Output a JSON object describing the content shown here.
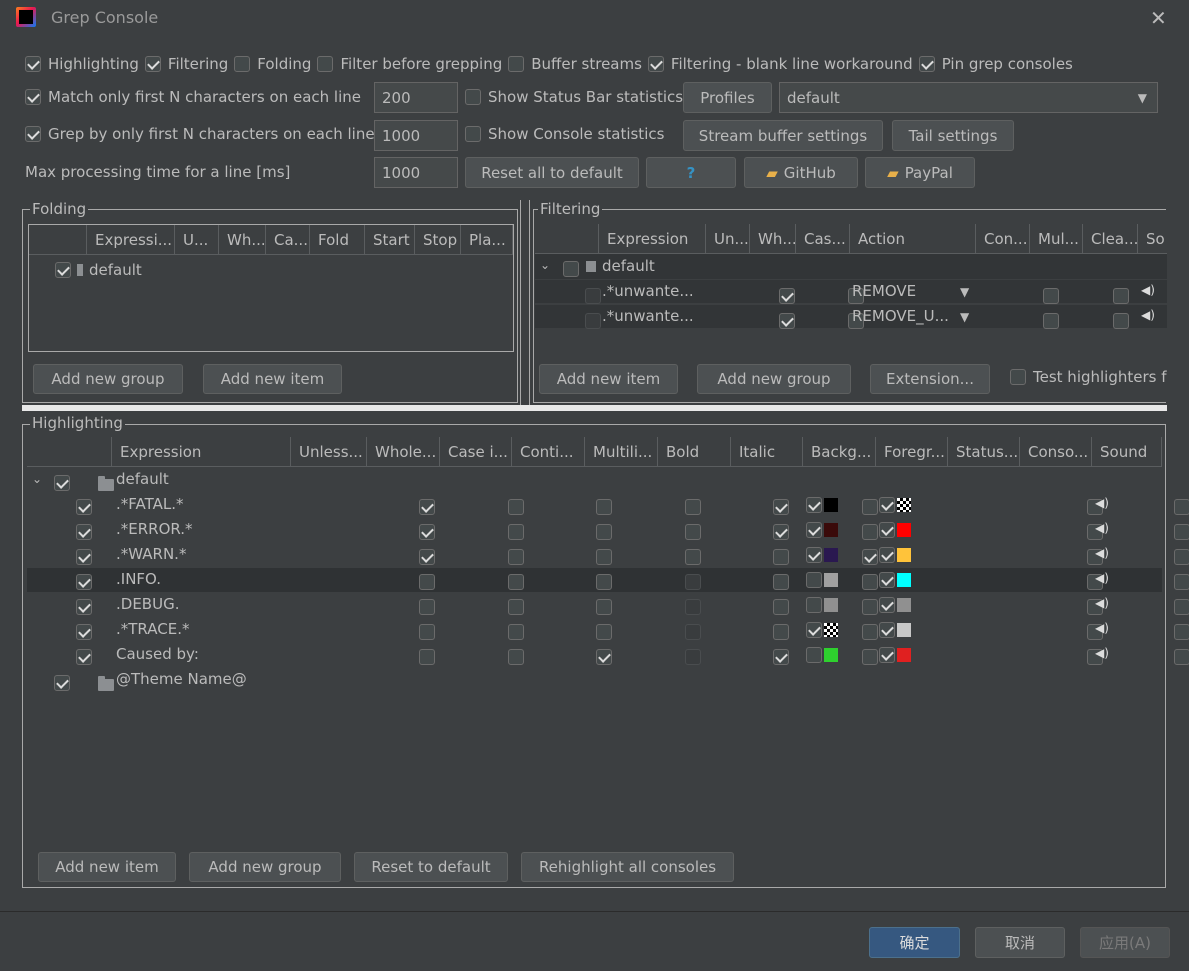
{
  "window": {
    "title": "Grep Console"
  },
  "options": {
    "row1": [
      {
        "label": "Highlighting",
        "checked": true
      },
      {
        "label": "Filtering",
        "checked": true
      },
      {
        "label": "Folding",
        "checked": false
      },
      {
        "label": "Filter before grepping",
        "checked": false
      },
      {
        "label": "Buffer streams",
        "checked": false
      },
      {
        "label": "Filtering - blank line workaround",
        "checked": true
      },
      {
        "label": "Pin grep consoles",
        "checked": true
      }
    ],
    "match_first_n": {
      "label": "Match only first N characters on each line",
      "checked": true,
      "value": "200"
    },
    "grep_first_n": {
      "label": "Grep by only first N characters on each line",
      "checked": true,
      "value": "1000"
    },
    "max_time": {
      "label": "Max processing time for a line [ms]",
      "value": "1000"
    },
    "status_bar_stats": {
      "label": "Show Status Bar statistics",
      "checked": false
    },
    "console_stats": {
      "label": "Show Console statistics",
      "checked": false
    },
    "profiles_label": "Profiles",
    "profile_selected": "default",
    "stream_buffer_label": "Stream buffer settings",
    "tail_settings_label": "Tail settings",
    "reset_all_label": "Reset all to default",
    "help_label": "?",
    "github_label": "GitHub",
    "paypal_label": "PayPal"
  },
  "folding": {
    "title": "Folding",
    "columns": [
      "Expressi...",
      "U...",
      "Wh...",
      "Ca...",
      "Fold",
      "Start",
      "Stop",
      "Pla..."
    ],
    "rows": [
      {
        "label": "default",
        "checked": true
      }
    ],
    "add_group": "Add new group",
    "add_item": "Add new item"
  },
  "filtering": {
    "title": "Filtering",
    "columns": [
      "Expression",
      "Un...",
      "Wh...",
      "Cas...",
      "Action",
      "Con...",
      "Mul...",
      "Clea...",
      "So"
    ],
    "group": "default",
    "rows": [
      {
        "expr": ".*unwante...",
        "action": "REMOVE"
      },
      {
        "expr": ".*unwante...",
        "action": "REMOVE_U..."
      }
    ],
    "add_item": "Add new item",
    "add_group": "Add new group",
    "extension": "Extension...",
    "test_label": "Test highlighters f"
  },
  "highlighting": {
    "title": "Highlighting",
    "columns": [
      "Expression",
      "Unless...",
      "Whole...",
      "Case i...",
      "Conti...",
      "Multili...",
      "Bold",
      "Italic",
      "Backg...",
      "Foregr...",
      "Status...",
      "Conso...",
      "Sound"
    ],
    "group": "default",
    "group2": "@Theme Name@",
    "rows": [
      {
        "expr": ".*FATAL.*",
        "whole": true,
        "cont": false,
        "bold": true,
        "italic": false,
        "bg_on": true,
        "bg": "#000000",
        "fg": "checker"
      },
      {
        "expr": ".*ERROR.*",
        "whole": true,
        "cont": false,
        "bold": true,
        "italic": false,
        "bg_on": true,
        "bg": "#3a0a0a",
        "fg": "#ff0000"
      },
      {
        "expr": ".*WARN.*",
        "whole": true,
        "cont": false,
        "bold": false,
        "italic": true,
        "bg_on": true,
        "bg": "#2a1850",
        "fg": "#ffc33a"
      },
      {
        "expr": ".INFO.",
        "whole": false,
        "cont": false,
        "bold": false,
        "italic": false,
        "bg_on": false,
        "bg": "#a0a0a0",
        "fg": "#00ffff"
      },
      {
        "expr": ".DEBUG.",
        "whole": false,
        "cont": false,
        "bold": false,
        "italic": false,
        "bg_on": false,
        "bg": "#909090",
        "fg": "#909090"
      },
      {
        "expr": ".*TRACE.*",
        "whole": false,
        "cont": false,
        "bold": false,
        "italic": false,
        "bg_on": true,
        "bg": "checker",
        "fg": "#c8c8c8"
      },
      {
        "expr": "Caused by:",
        "whole": false,
        "cont": true,
        "bold": true,
        "italic": false,
        "bg_on": false,
        "bg": "#2ed12e",
        "fg": "#e02020"
      }
    ],
    "add_item": "Add new item",
    "add_group": "Add new group",
    "reset": "Reset to default",
    "rehighlight": "Rehighlight all consoles"
  },
  "footer": {
    "ok": "确定",
    "cancel": "取消",
    "apply": "应用(A)"
  }
}
